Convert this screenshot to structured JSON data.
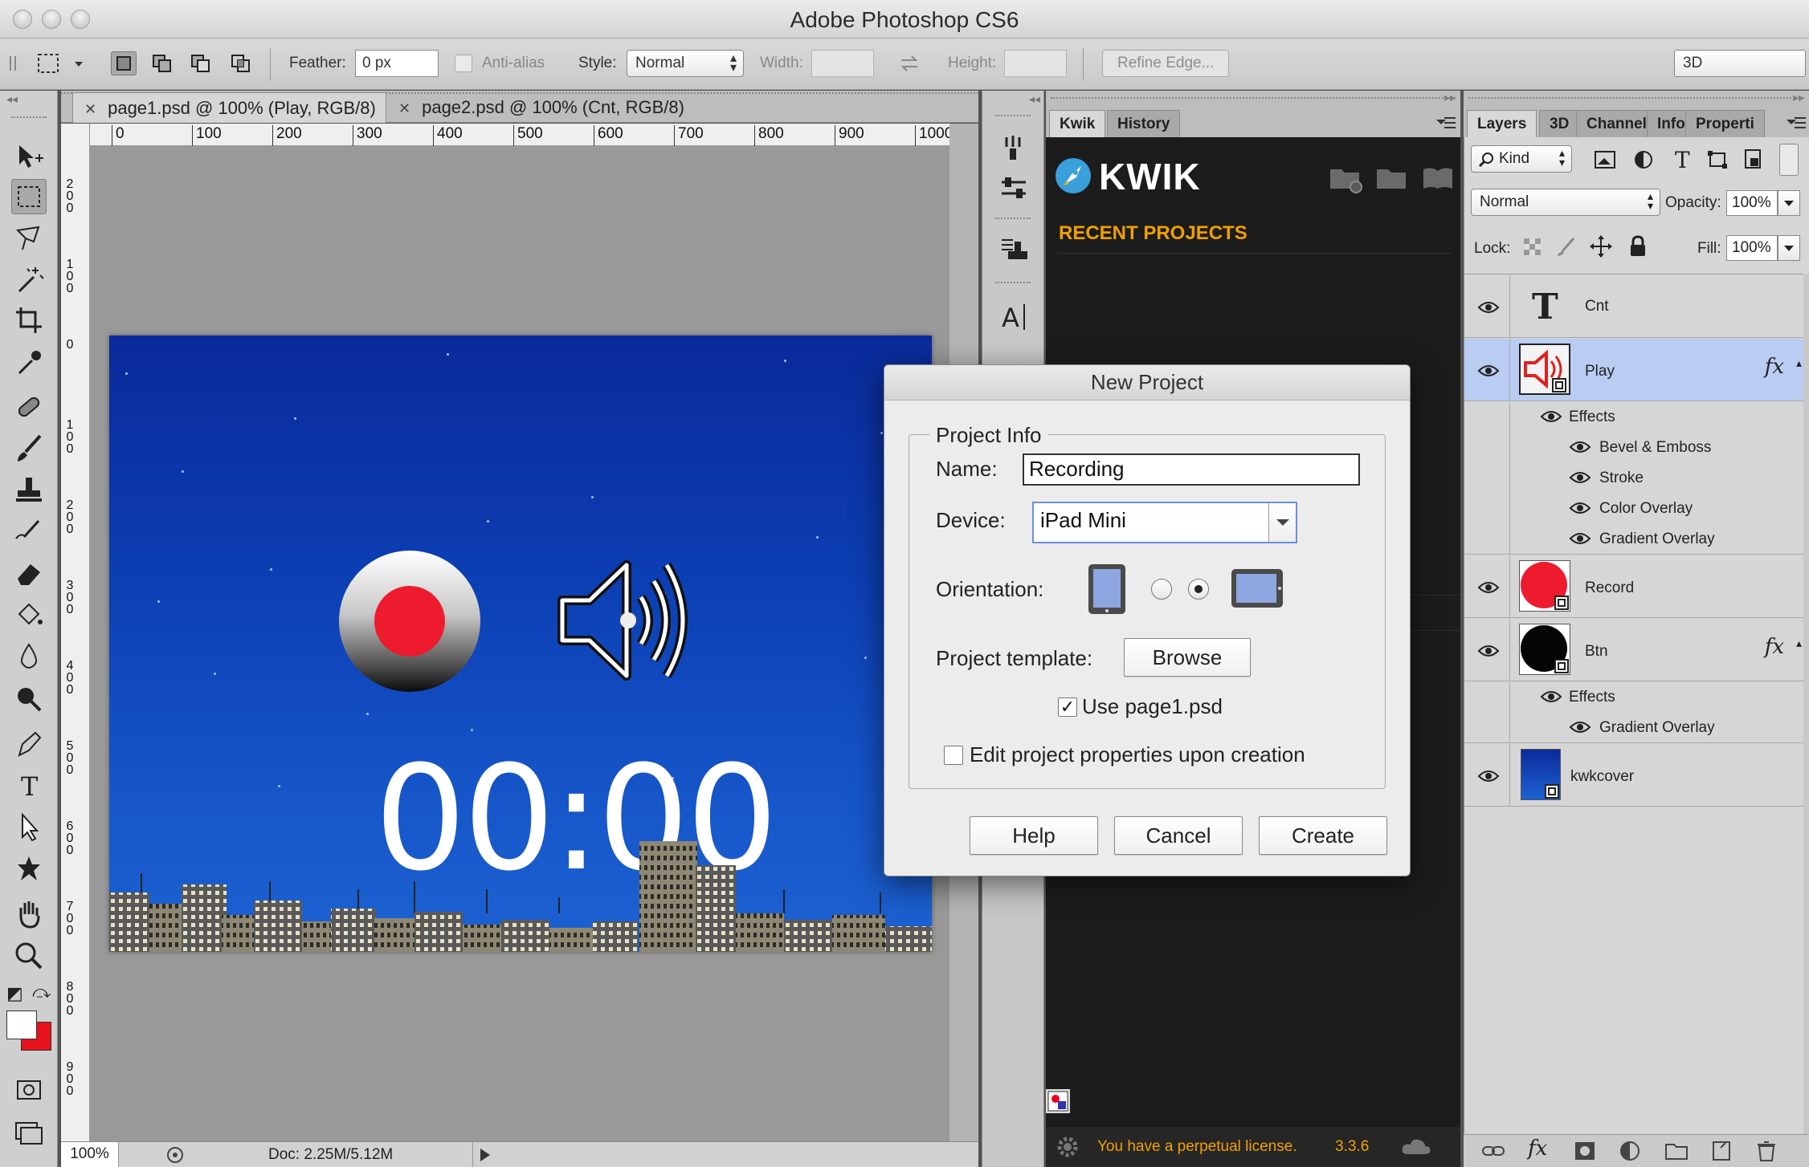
{
  "window": {
    "title": "Adobe Photoshop CS6"
  },
  "options_bar": {
    "feather_label": "Feather:",
    "feather_value": "0 px",
    "antialias_label": "Anti-alias",
    "style_label": "Style:",
    "style_value": "Normal",
    "width_label": "Width:",
    "height_label": "Height:",
    "refine_edge_label": "Refine Edge...",
    "workspace_value": "3D"
  },
  "documents": {
    "tabs": [
      {
        "label": "page1.psd @ 100% (Play, RGB/8)",
        "close": "✕"
      },
      {
        "label": "page2.psd @ 100% (Cnt, RGB/8)",
        "close": "✕"
      }
    ],
    "ruler_h": [
      "0",
      "100",
      "200",
      "300",
      "400",
      "500",
      "600",
      "700",
      "800",
      "900",
      "1000"
    ],
    "ruler_v": [
      "200",
      "100",
      "0",
      "100",
      "200",
      "300",
      "400",
      "500",
      "600",
      "700",
      "800",
      "900"
    ],
    "artwork_timer": "00:00",
    "status": {
      "zoom": "100%",
      "doc_info": "Doc: 2.25M/5.12M"
    }
  },
  "kwik_panel": {
    "tabs": [
      "Kwik",
      "History"
    ],
    "logo_text": "KWIK",
    "recent_projects_label": "RECENT PROJECTS",
    "license_text": "You have a perpetual license.",
    "version": "3.3.6",
    "accent_color": "#f0a000"
  },
  "layers_panel": {
    "tabs": [
      "Layers",
      "3D",
      "Channel",
      "Info",
      "Properti"
    ],
    "kind_label": "Kind",
    "blend_mode": "Normal",
    "opacity_label": "Opacity:",
    "opacity_value": "100%",
    "lock_label": "Lock:",
    "fill_label": "Fill:",
    "fill_value": "100%",
    "layers": [
      {
        "name": "Cnt",
        "type": "text",
        "fx": "",
        "selected": false
      },
      {
        "name": "Play",
        "type": "smart",
        "fx": "fx",
        "selected": true,
        "effects_label": "Effects",
        "effects": [
          "Bevel & Emboss",
          "Stroke",
          "Color Overlay",
          "Gradient Overlay"
        ]
      },
      {
        "name": "Record",
        "type": "smart",
        "fx": "",
        "selected": false
      },
      {
        "name": "Btn",
        "type": "smart",
        "fx": "fx",
        "selected": false,
        "effects_label": "Effects",
        "effects": [
          "Gradient Overlay"
        ]
      },
      {
        "name": "kwkcover",
        "type": "smart",
        "fx": "",
        "selected": false
      }
    ]
  },
  "dialog": {
    "title": "New Project",
    "group_title": "Project Info",
    "name_label": "Name:",
    "name_value": "Recording",
    "device_label": "Device:",
    "device_value": "iPad Mini",
    "orientation_label": "Orientation:",
    "orientation_selected": "landscape",
    "template_label": "Project template:",
    "browse_label": "Browse",
    "use_page_label": "Use page1.psd",
    "use_page_checked": true,
    "edit_props_label": "Edit project properties upon creation",
    "edit_props_checked": false,
    "help_label": "Help",
    "cancel_label": "Cancel",
    "create_label": "Create"
  }
}
